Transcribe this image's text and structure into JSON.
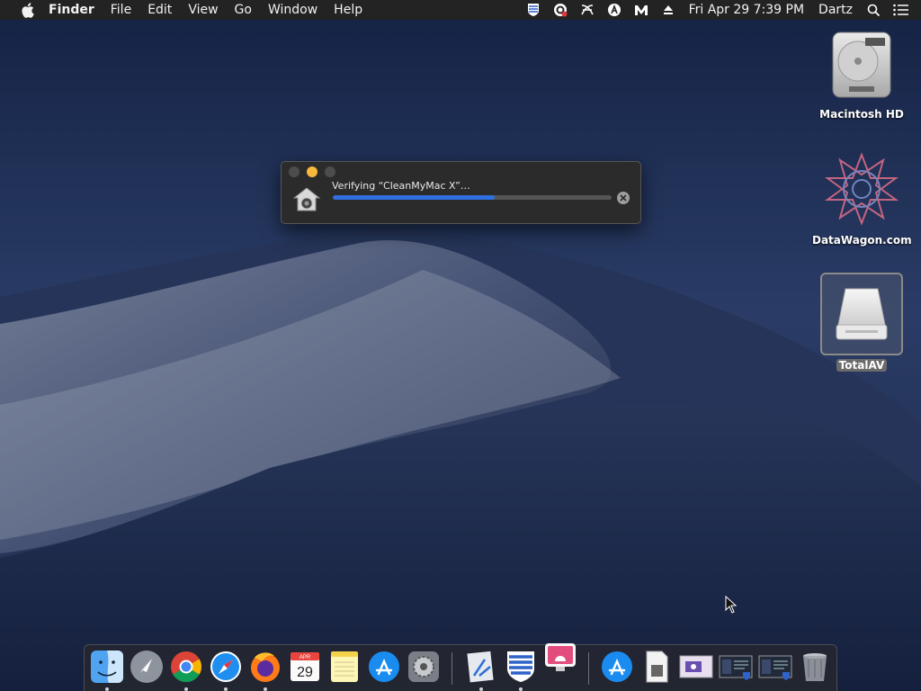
{
  "menubar": {
    "app_name": "Finder",
    "menus": [
      "File",
      "Edit",
      "View",
      "Go",
      "Window",
      "Help"
    ],
    "status_icons": [
      "totalav-shield-icon",
      "cleanmymac-icon",
      "ninja-icon",
      "bitdefender-icon",
      "malwarebytes-icon",
      "eject-icon"
    ],
    "clock": "Fri Apr 29  7:39 PM",
    "user": "Dartz"
  },
  "desktop": {
    "icons": [
      {
        "label": "Macintosh HD",
        "icon": "hard-drive-icon"
      },
      {
        "label": "DataWagon.com",
        "icon": "datawagon-logo-icon"
      },
      {
        "label": "TotalAV",
        "icon": "external-disk-icon",
        "selected": true
      }
    ]
  },
  "progress_window": {
    "message": "Verifying “CleanMyMac X”…",
    "progress": 0.58,
    "icon": "installer-icon"
  },
  "dock": {
    "apps": [
      "Finder",
      "Launchpad",
      "Google Chrome",
      "Safari",
      "Firefox",
      "Calendar",
      "Notes",
      "App Store",
      "System Preferences",
      "Xcode",
      "TotalAV",
      "CleanMyMac X"
    ],
    "calendar_month": "APR",
    "calendar_day": "29",
    "others": [
      "Applications",
      "Document",
      "Screenshot",
      "Screenshot",
      "Screenshot",
      "Trash"
    ]
  },
  "colors": {
    "menubar_bg": "#232323",
    "accent_blue": "#2f6fe0",
    "minimize_yellow": "#f6b93b"
  }
}
